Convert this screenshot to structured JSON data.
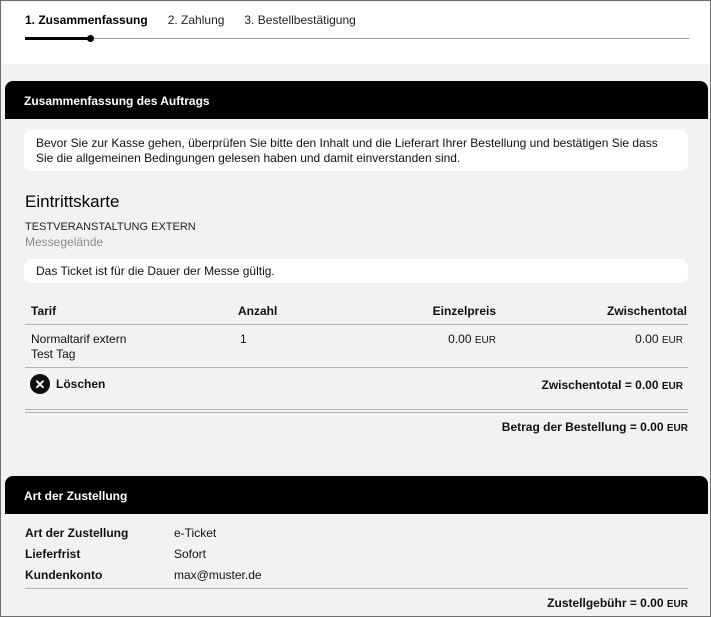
{
  "stepper": {
    "steps": [
      {
        "label": "1. Zusammenfassung",
        "active": true
      },
      {
        "label": "2. Zahlung",
        "active": false
      },
      {
        "label": "3. Bestellbestätigung",
        "active": false
      }
    ]
  },
  "summary": {
    "header": "Zusammenfassung des Auftrags",
    "intro": "Bevor Sie zur Kasse gehen, überprüfen Sie bitte den Inhalt und die Lieferart Ihrer Bestellung und bestätigen Sie dass Sie die allgemeinen Bedingungen gelesen haben und damit einverstanden sind.",
    "item_type": "Eintrittskarte",
    "event_name": "TESTVERANSTALTUNG EXTERN",
    "venue": "Messegelände",
    "ticket_notice": "Das Ticket ist für die Dauer der Messe gültig.",
    "table": {
      "headers": {
        "tarif": "Tarif",
        "anzahl": "Anzahl",
        "einzelpreis": "Einzelpreis",
        "zwischentotal": "Zwischentotal"
      },
      "rows": [
        {
          "tarif_line1": "Normaltarif extern",
          "tarif_line2": "Test Tag",
          "anzahl": "1",
          "einzelpreis": "0.00",
          "einzelpreis_cur": "EUR",
          "zwischentotal": "0.00",
          "zwischentotal_cur": "EUR"
        }
      ]
    },
    "delete_label": "Löschen",
    "subtotal_label": "Zwischentotal = 0.00",
    "subtotal_cur": "EUR",
    "order_total_label": "Betrag der Bestellung = 0.00",
    "order_total_cur": "EUR"
  },
  "delivery": {
    "header": "Art der Zustellung",
    "rows": [
      {
        "label": "Art der Zustellung",
        "value": "e-Ticket"
      },
      {
        "label": "Lieferfrist",
        "value": "Sofort"
      },
      {
        "label": "Kundenkonto",
        "value": "max@muster.de"
      }
    ],
    "fee_label": "Zustellgebühr = 0.00",
    "fee_cur": "EUR"
  },
  "icons": {
    "delete": "close-circle-icon"
  }
}
